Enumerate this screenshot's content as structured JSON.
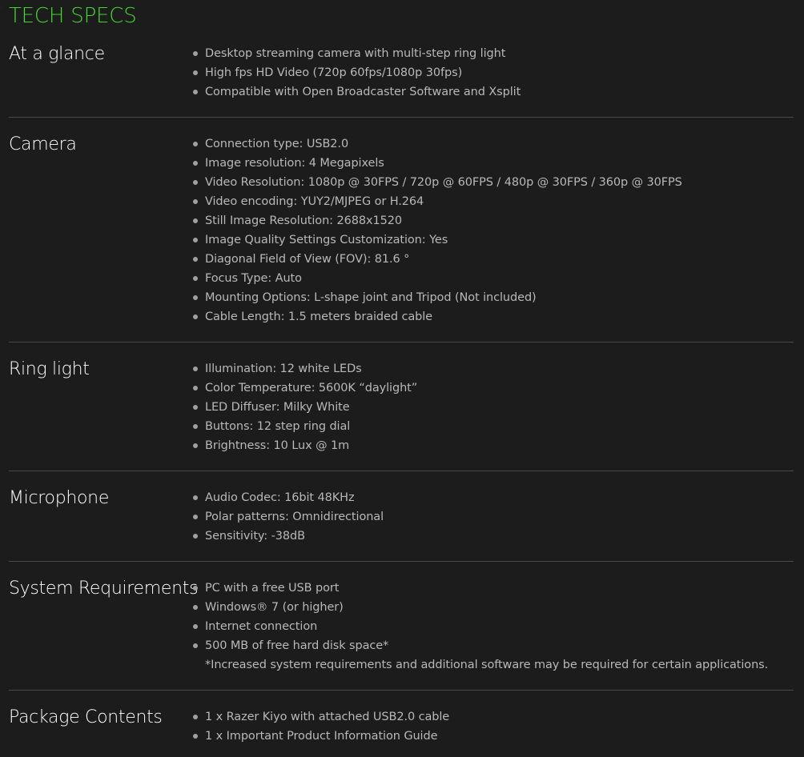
{
  "title": "TECH SPECS",
  "colors": {
    "accent": "#44d62c",
    "background": "#1c1c1c",
    "label": "#ffffff",
    "text": "#b8b8b8",
    "divider": "#4a4a4a"
  },
  "sections": [
    {
      "label": "At a glance",
      "items": [
        "Desktop streaming camera with multi-step ring light",
        "High fps HD Video (720p 60fps/1080p 30fps)",
        "Compatible with Open Broadcaster Software and Xsplit"
      ]
    },
    {
      "label": "Camera",
      "items": [
        "Connection type: USB2.0",
        "Image resolution: 4 Megapixels",
        "Video Resolution: 1080p @ 30FPS / 720p @ 60FPS / 480p @ 30FPS / 360p @ 30FPS",
        "Video encoding: YUY2/MJPEG or H.264",
        "Still Image Resolution: 2688x1520",
        "Image Quality Settings Customization: Yes",
        "Diagonal Field of View (FOV): 81.6 °",
        "Focus Type: Auto",
        "Mounting Options: L-shape joint and Tripod (Not included)",
        "Cable Length: 1.5 meters braided cable"
      ]
    },
    {
      "label": "Ring light",
      "items": [
        "Illumination: 12 white LEDs",
        "Color Temperature: 5600K “daylight”",
        "LED Diffuser: Milky White",
        "Buttons: 12 step ring dial",
        "Brightness: 10 Lux @ 1m"
      ]
    },
    {
      "label": "Microphone",
      "items": [
        "Audio Codec: 16bit 48KHz",
        "Polar patterns: Omnidirectional",
        "Sensitivity: -38dB"
      ]
    },
    {
      "label": "System Requirements",
      "items": [
        "PC with a free USB port",
        "Windows® 7 (or higher)",
        "Internet connection",
        "500 MB of free hard disk space*"
      ],
      "note": "*Increased system requirements and additional software may be required for certain applications."
    },
    {
      "label": "Package Contents",
      "items": [
        "1 x Razer Kiyo with attached USB2.0 cable",
        "1 x Important Product Information Guide"
      ]
    }
  ]
}
